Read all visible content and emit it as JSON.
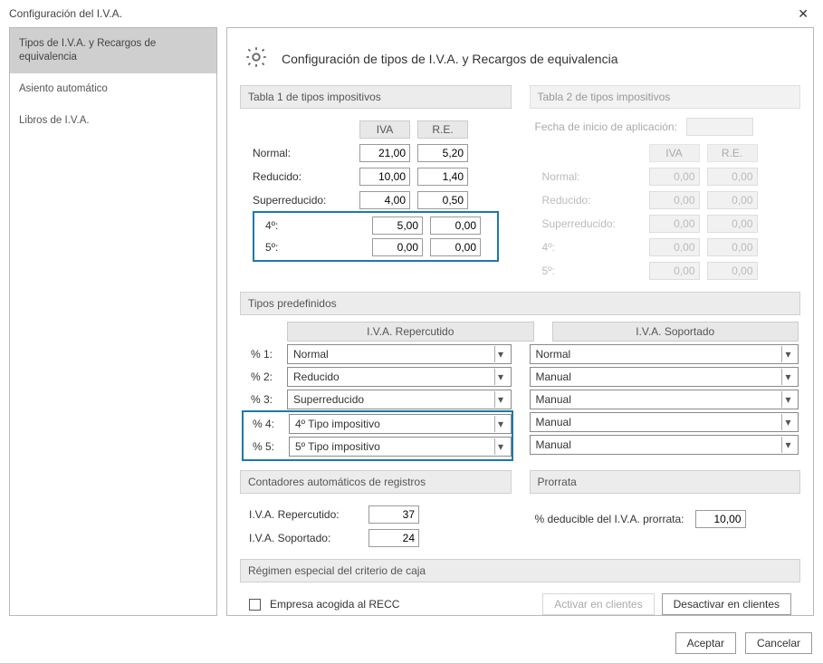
{
  "window": {
    "title": "Configuración del I.V.A."
  },
  "sidebar": {
    "items": [
      {
        "label": "Tipos de I.V.A. y Recargos de equivalencia"
      },
      {
        "label": "Asiento automático"
      },
      {
        "label": "Libros de I.V.A."
      }
    ]
  },
  "main": {
    "title": "Configuración de tipos de I.V.A. y Recargos de equivalencia",
    "table1": {
      "header": "Tabla 1 de tipos impositivos",
      "col_iva": "IVA",
      "col_re": "R.E.",
      "rows": {
        "normal": {
          "label": "Normal:",
          "iva": "21,00",
          "re": "5,20"
        },
        "reducido": {
          "label": "Reducido:",
          "iva": "10,00",
          "re": "1,40"
        },
        "super": {
          "label": "Superreducido:",
          "iva": "4,00",
          "re": "0,50"
        },
        "r4": {
          "label": "4º:",
          "iva": "5,00",
          "re": "0,00"
        },
        "r5": {
          "label": "5º:",
          "iva": "0,00",
          "re": "0,00"
        }
      }
    },
    "table2": {
      "header": "Tabla 2 de tipos impositivos",
      "apply_date_label": "Fecha de inicio de aplicación:",
      "col_iva": "IVA",
      "col_re": "R.E.",
      "rows": {
        "normal": {
          "label": "Normal:",
          "iva": "0,00",
          "re": "0,00"
        },
        "reducido": {
          "label": "Reducido:",
          "iva": "0,00",
          "re": "0,00"
        },
        "super": {
          "label": "Superreducido:",
          "iva": "0,00",
          "re": "0,00"
        },
        "r4": {
          "label": "4º:",
          "iva": "0,00",
          "re": "0,00"
        },
        "r5": {
          "label": "5º:",
          "iva": "0,00",
          "re": "0,00"
        }
      }
    },
    "predef": {
      "header": "Tipos predefinidos",
      "col_rep": "I.V.A. Repercutido",
      "col_sop": "I.V.A. Soportado",
      "rows": [
        {
          "label": "% 1:",
          "rep": "Normal",
          "sop": "Normal"
        },
        {
          "label": "% 2:",
          "rep": "Reducido",
          "sop": "Manual"
        },
        {
          "label": "% 3:",
          "rep": "Superreducido",
          "sop": "Manual"
        },
        {
          "label": "% 4:",
          "rep": "4º Tipo impositivo",
          "sop": "Manual"
        },
        {
          "label": "% 5:",
          "rep": "5º Tipo impositivo",
          "sop": "Manual"
        }
      ]
    },
    "counters": {
      "header": "Contadores automáticos de registros",
      "rep_label": "I.V.A. Repercutido:",
      "rep_val": "37",
      "sop_label": "I.V.A. Soportado:",
      "sop_val": "24"
    },
    "prorrata": {
      "header": "Prorrata",
      "label": "% deducible del I.V.A. prorrata:",
      "value": "10,00"
    },
    "recc": {
      "header": "Régimen especial del criterio de caja",
      "checkbox_label": "Empresa acogida al RECC",
      "btn_activate": "Activar en clientes",
      "btn_deactivate": "Desactivar en clientes"
    }
  },
  "footer": {
    "accept": "Aceptar",
    "cancel": "Cancelar"
  }
}
